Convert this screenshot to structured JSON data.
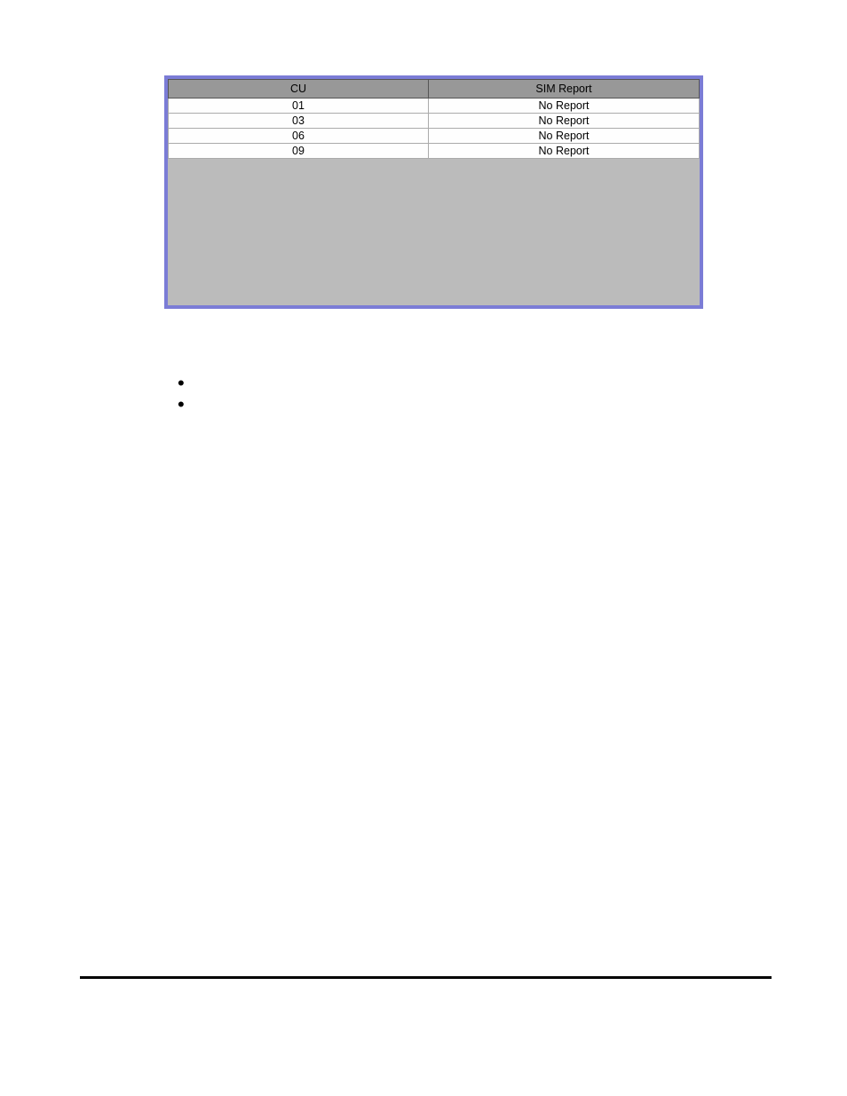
{
  "table": {
    "headers": {
      "cu": "CU",
      "sim_report": "SIM Report"
    },
    "rows": [
      {
        "cu": "01",
        "sim_report": "No Report"
      },
      {
        "cu": "03",
        "sim_report": "No Report"
      },
      {
        "cu": "06",
        "sim_report": "No Report"
      },
      {
        "cu": "09",
        "sim_report": "No Report"
      }
    ]
  },
  "bullets": [
    "",
    ""
  ]
}
